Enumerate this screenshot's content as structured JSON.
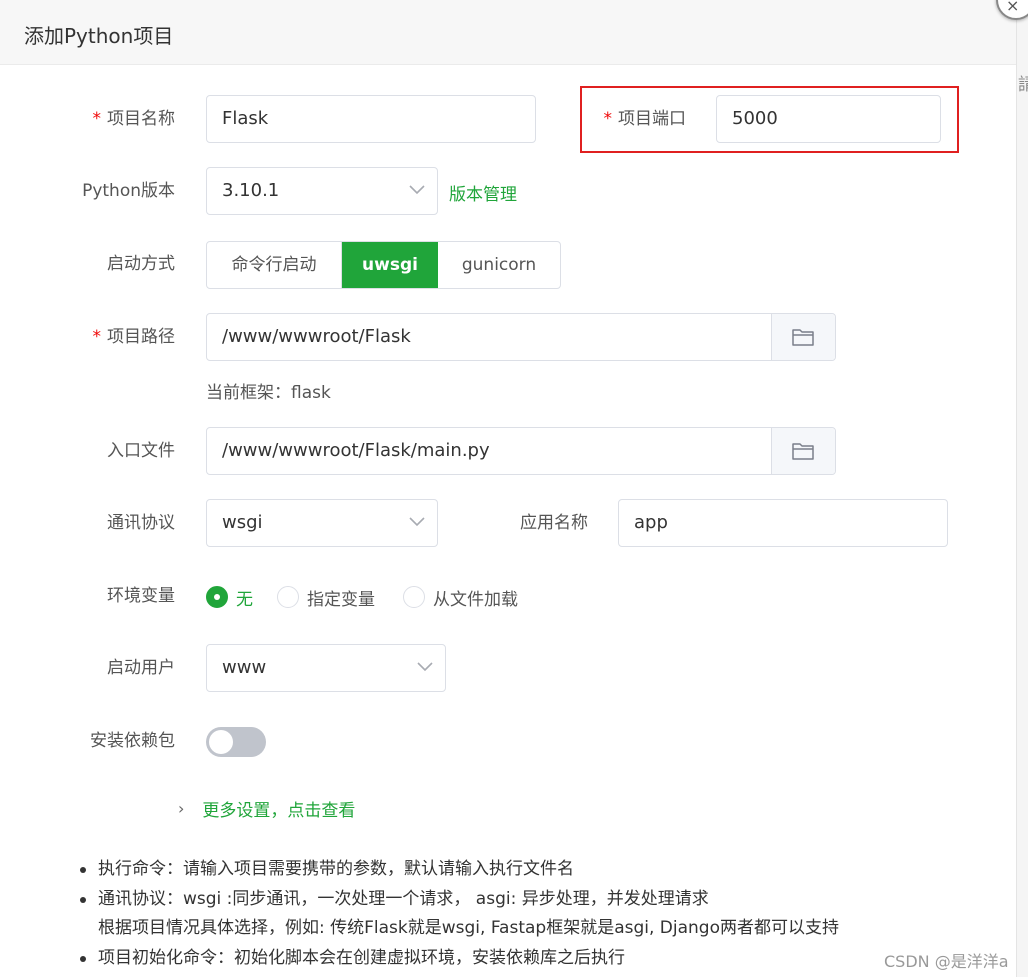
{
  "dialog": {
    "title": "添加Python项目",
    "close_icon": "×"
  },
  "background_fragment": "請",
  "form": {
    "project_name": {
      "label": "项目名称",
      "required": "*",
      "value": "Flask"
    },
    "project_port": {
      "label": "项目端口",
      "required": "*",
      "value": "5000"
    },
    "python_version": {
      "label": "Python版本",
      "value": "3.10.1",
      "manage_link": "版本管理"
    },
    "start_mode": {
      "label": "启动方式",
      "options": [
        "命令行启动",
        "uwsgi",
        "gunicorn"
      ],
      "selected": "uwsgi"
    },
    "project_path": {
      "label": "项目路径",
      "required": "*",
      "value": "/www/wwwroot/Flask",
      "framework_hint": "当前框架：flask"
    },
    "entry_file": {
      "label": "入口文件",
      "value": "/www/wwwroot/Flask/main.py"
    },
    "protocol": {
      "label": "通讯协议",
      "value": "wsgi"
    },
    "app_name": {
      "label": "应用名称",
      "value": "app"
    },
    "env_vars": {
      "label": "环境变量",
      "options": [
        "无",
        "指定变量",
        "从文件加载"
      ],
      "selected": "无"
    },
    "run_user": {
      "label": "启动用户",
      "value": "www"
    },
    "install_deps": {
      "label": "安装依赖包",
      "enabled": false
    },
    "more_settings": "更多设置，点击查看"
  },
  "notes": [
    "执行命令：请输入项目需要携带的参数，默认请输入执行文件名",
    "通讯协议：wsgi :同步通讯，一次处理一个请求，  asgi: 异步处理，并发处理请求",
    "根据项目情况具体选择，例如: 传统Flask就是wsgi, Fastap框架就是asgi, Django两者都可以支持",
    "项目初始化命令：初始化脚本会在创建虚拟环境，安装依赖库之后执行"
  ],
  "watermark": "CSDN @是洋洋a",
  "colors": {
    "accent": "#20a53a",
    "required": "#ef0808",
    "highlight_box": "#e02020"
  },
  "icons": [
    "close-icon",
    "chevron-down-icon",
    "folder-icon",
    "chevron-right-icon"
  ]
}
